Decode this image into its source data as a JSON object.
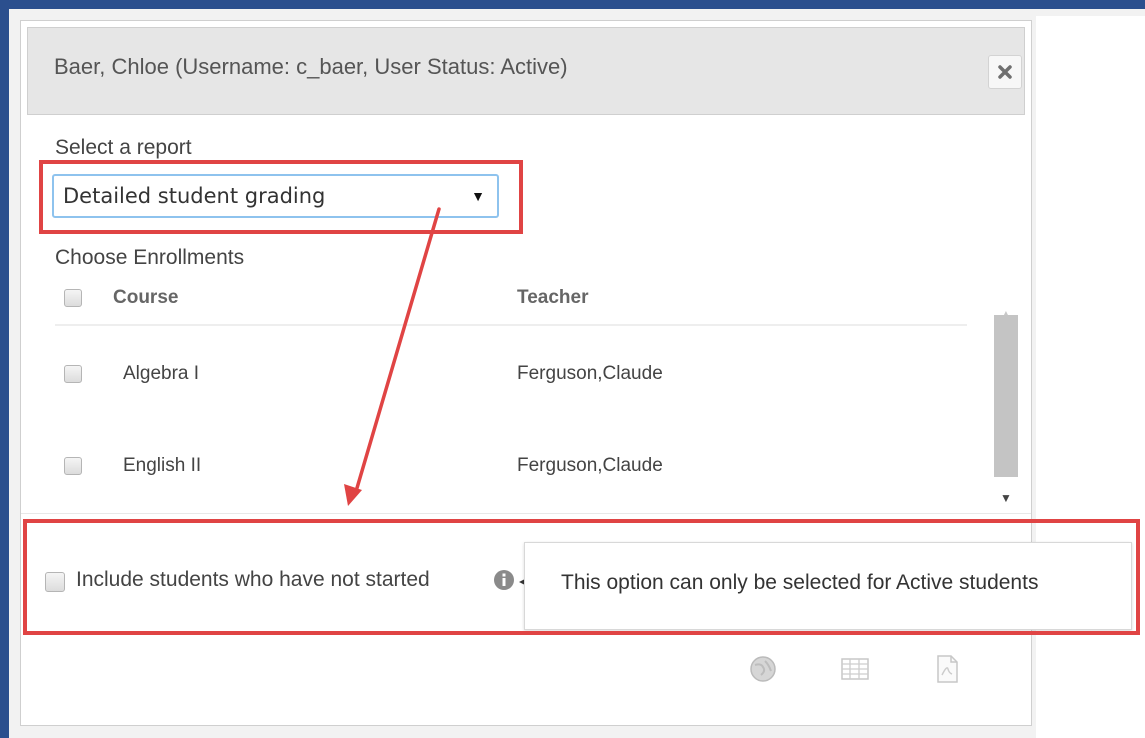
{
  "dialog": {
    "title": "Baer, Chloe (Username: c_baer, User Status: Active)",
    "close_icon": "close-icon"
  },
  "report": {
    "label": "Select a report",
    "selected": "Detailed student grading",
    "caret": "▼"
  },
  "enrollments": {
    "label": "Choose Enrollments",
    "columns": [
      "Course",
      "Teacher"
    ],
    "rows": [
      {
        "course": "Algebra I",
        "teacher": "Ferguson,Claude"
      },
      {
        "course": "English II",
        "teacher": "Ferguson,Claude"
      }
    ]
  },
  "options": {
    "include_not_started_label": "Include students who have not started",
    "tooltip_text": "This option can only be selected for Active students"
  },
  "toolbar": {
    "icons": [
      "globe-icon",
      "table-grid-icon",
      "pdf-document-icon"
    ]
  },
  "colors": {
    "highlight": "#e04444",
    "frame": "#2b4f8e",
    "select_focus": "#8ec3ee"
  }
}
